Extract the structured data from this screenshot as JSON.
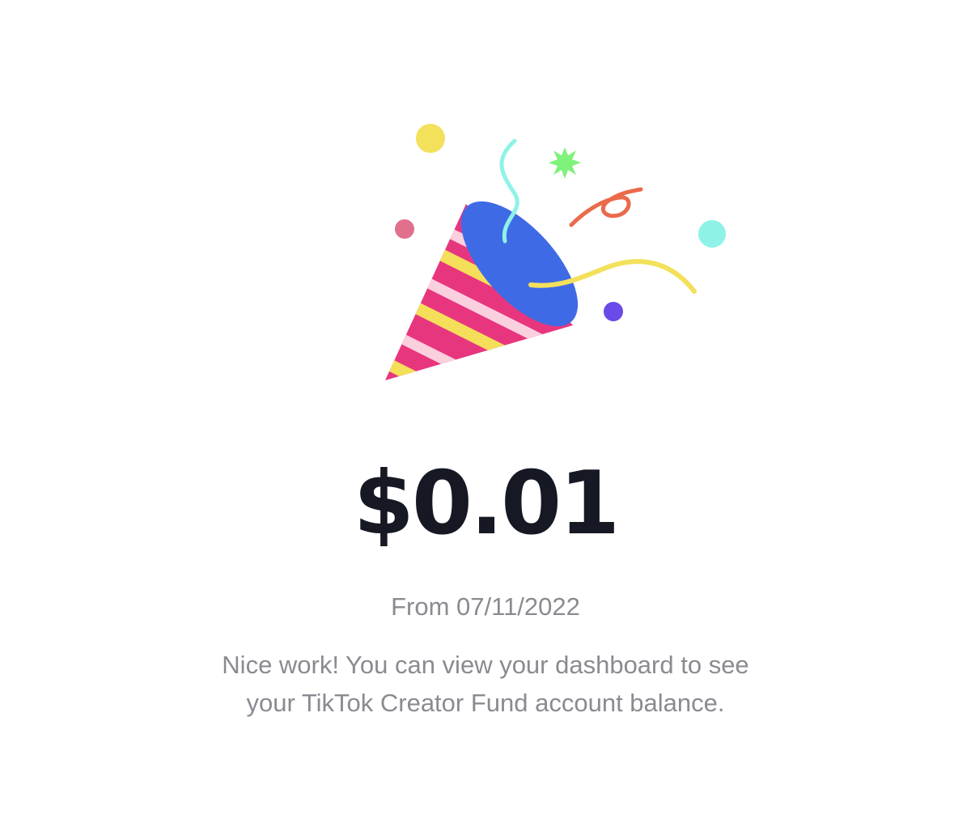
{
  "reward": {
    "amount": "$0.01",
    "date_text": "From 07/11/2022",
    "message": "Nice work! You can view your dashboard to see your TikTok Creator Fund account balance.",
    "illustration_icon": "party-popper-icon"
  },
  "colors": {
    "background": "#ffffff",
    "amount_text": "#161823",
    "secondary_text": "#8a8b91",
    "popper_body": "#e8367e",
    "popper_stripe_yellow": "#f5df5a",
    "popper_stripe_pink": "#fbd0de",
    "popper_opening": "#3f6ae6",
    "confetti_yellow": "#f3e05b",
    "confetti_teal": "#8ef3e6",
    "confetti_green": "#7ef27a",
    "confetti_orange": "#ea6a4a",
    "confetti_pink": "#e0708c",
    "confetti_purple": "#6a4ae8"
  }
}
